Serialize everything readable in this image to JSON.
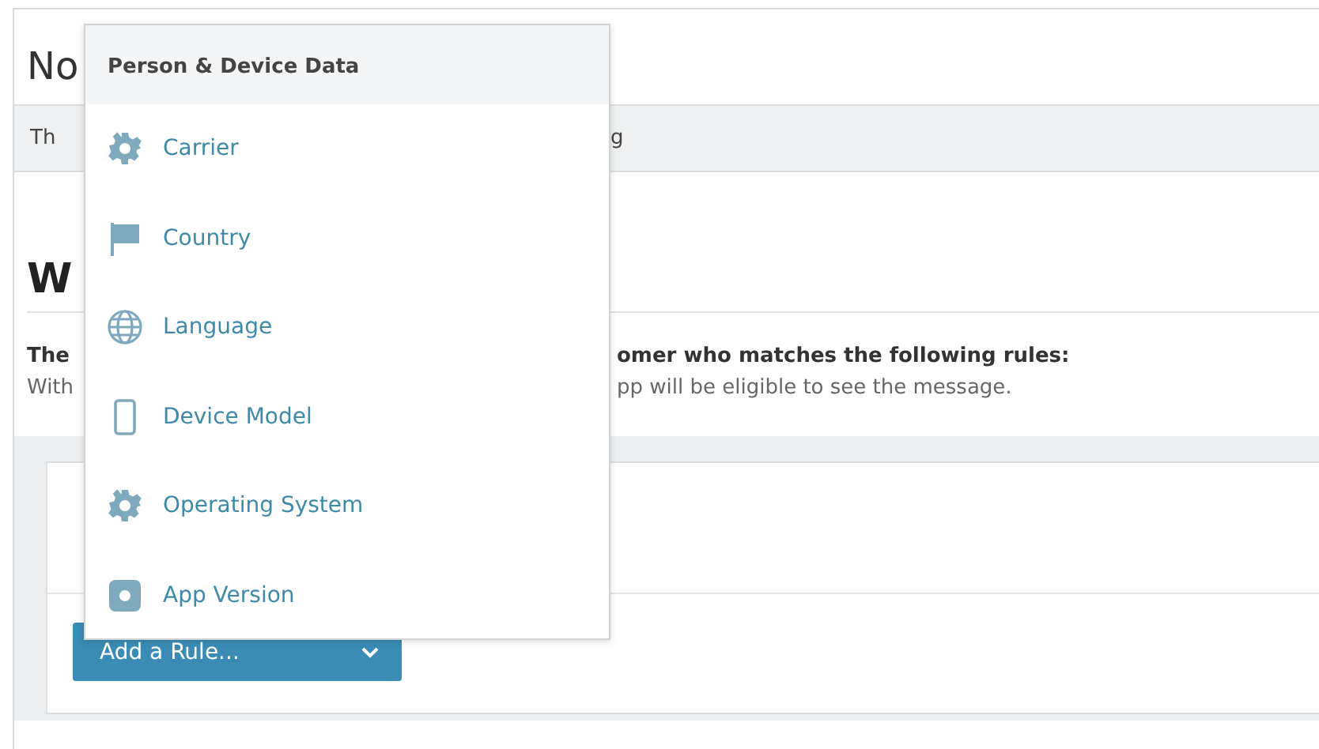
{
  "page": {
    "title": "No",
    "bar_left": "Th",
    "bar_right": "g",
    "heading": "W",
    "rules_left": "The",
    "rules_right": "omer who matches the following rules:",
    "note_left": "With",
    "note_right": "pp will be eligible to see the message."
  },
  "rule_button": {
    "label": "Add a Rule..."
  },
  "menu": {
    "header": "Person & Device Data",
    "items": [
      {
        "label": "Carrier",
        "kind": "gear"
      },
      {
        "label": "Country",
        "kind": "flag"
      },
      {
        "label": "Language",
        "kind": "globe"
      },
      {
        "label": "Device Model",
        "kind": "phone"
      },
      {
        "label": "Operating System",
        "kind": "gear"
      },
      {
        "label": "App Version",
        "kind": "app"
      }
    ]
  }
}
